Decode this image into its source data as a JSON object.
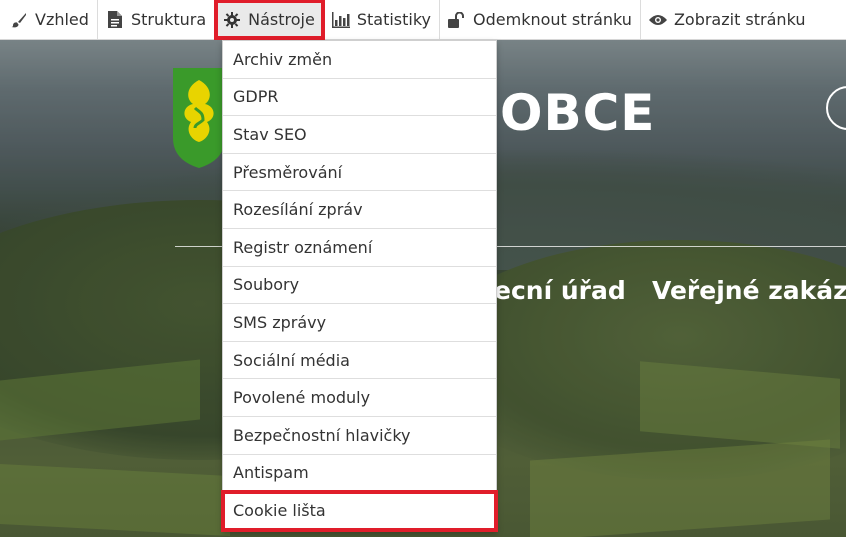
{
  "toolbar": {
    "items": [
      {
        "label": "Vzhled",
        "icon": "brush-icon"
      },
      {
        "label": "Struktura",
        "icon": "document-icon"
      },
      {
        "label": "Nástroje",
        "icon": "gear-icon"
      },
      {
        "label": "Statistiky",
        "icon": "bar-chart-icon"
      },
      {
        "label": "Odemknout stránku",
        "icon": "unlock-icon"
      },
      {
        "label": "Zobrazit stránku",
        "icon": "eye-icon"
      }
    ],
    "active_item": "Nástroje"
  },
  "tools_menu": {
    "items": [
      "Archiv změn",
      "GDPR",
      "Stav SEO",
      "Přesměrování",
      "Rozesílání zpráv",
      "Registr oznámení",
      "Soubory",
      "SMS zprávy",
      "Sociální média",
      "Povolené moduly",
      "Bezpečnostní hlavičky",
      "Antispam",
      "Cookie lišta"
    ],
    "highlighted_item": "Cookie lišta"
  },
  "site": {
    "title_fragment": "OBCE",
    "nav": [
      "ecní úřad",
      "Veřejné zakáz"
    ]
  },
  "colors": {
    "highlight": "#e01d2a",
    "crest_green": "#3a9a2a",
    "crest_yellow": "#e8d400"
  }
}
